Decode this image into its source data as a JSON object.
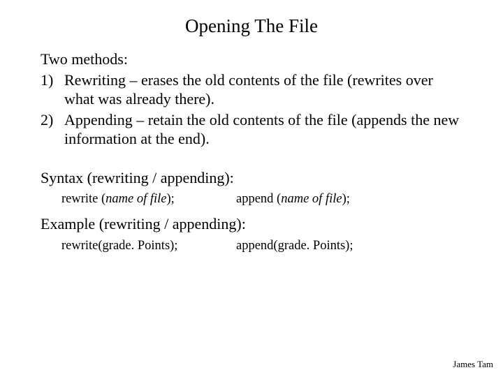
{
  "title": "Opening The File",
  "intro": "Two methods:",
  "items": [
    {
      "num": "1)",
      "text": "Rewriting – erases the old contents of the file (rewrites over what was already there)."
    },
    {
      "num": "2)",
      "text": "Appending – retain the old contents of the file (appends the new information at the end)."
    }
  ],
  "syntax": {
    "heading": "Syntax (rewriting / appending):",
    "left_pre": "rewrite (",
    "left_ital": "name of file",
    "left_post": ");",
    "right_pre": "append (",
    "right_ital": "name of file",
    "right_post": ");"
  },
  "example": {
    "heading": "Example (rewriting / appending):",
    "left": "rewrite(grade. Points);",
    "right": "append(grade. Points);"
  },
  "footer": "James Tam"
}
